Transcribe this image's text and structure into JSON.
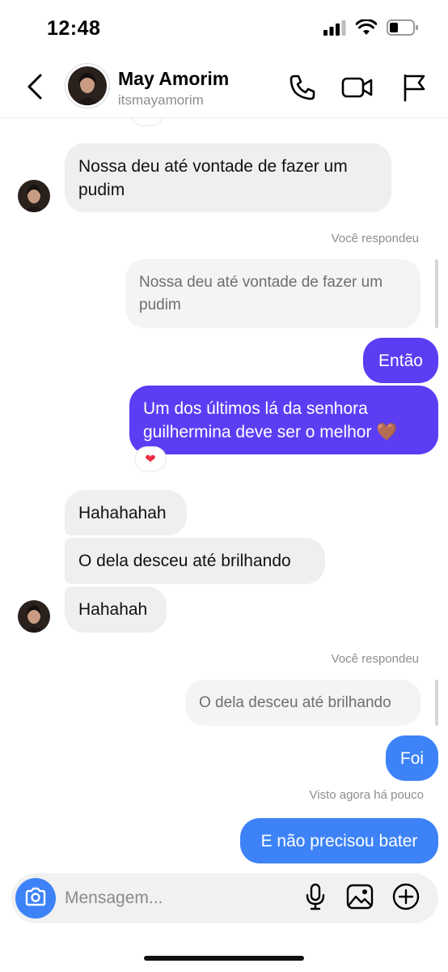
{
  "status_bar": {
    "time": "12:48"
  },
  "header": {
    "name": "May Amorim",
    "username": "itsmayamorim"
  },
  "messages": {
    "m1_line1": "Nossa deu até vontade de fazer um",
    "m1_line2": "pudim",
    "reply_label_1": "Você respondeu",
    "q1_line1": "Nossa deu até vontade de fazer um",
    "q1_line2": "pudim",
    "m2": "Então",
    "m3_line1": "Um dos últimos lá da senhora",
    "m3_line2": "guilhermina deve ser o melhor 🤎",
    "m3_reaction": "❤",
    "m4": "Hahahahah",
    "m5": "O dela desceu até brilhando",
    "m6": "Hahahah",
    "reply_label_2": "Você respondeu",
    "q2": "O dela desceu até brilhando",
    "m7": "Foi",
    "seen_label": "Visto agora há pouco",
    "m8": "E não precisou bater"
  },
  "composer": {
    "placeholder": "Mensagem..."
  },
  "colors": {
    "outgoing_purple": "#5c3df4",
    "outgoing_blue": "#3d83f7",
    "incoming": "#efefef"
  },
  "icons": {
    "back": "chevron-left-icon",
    "call": "phone-icon",
    "video": "video-camera-icon",
    "report": "flag-icon",
    "camera": "camera-icon",
    "mic": "microphone-icon",
    "gallery": "image-icon",
    "add": "plus-circle-icon"
  }
}
